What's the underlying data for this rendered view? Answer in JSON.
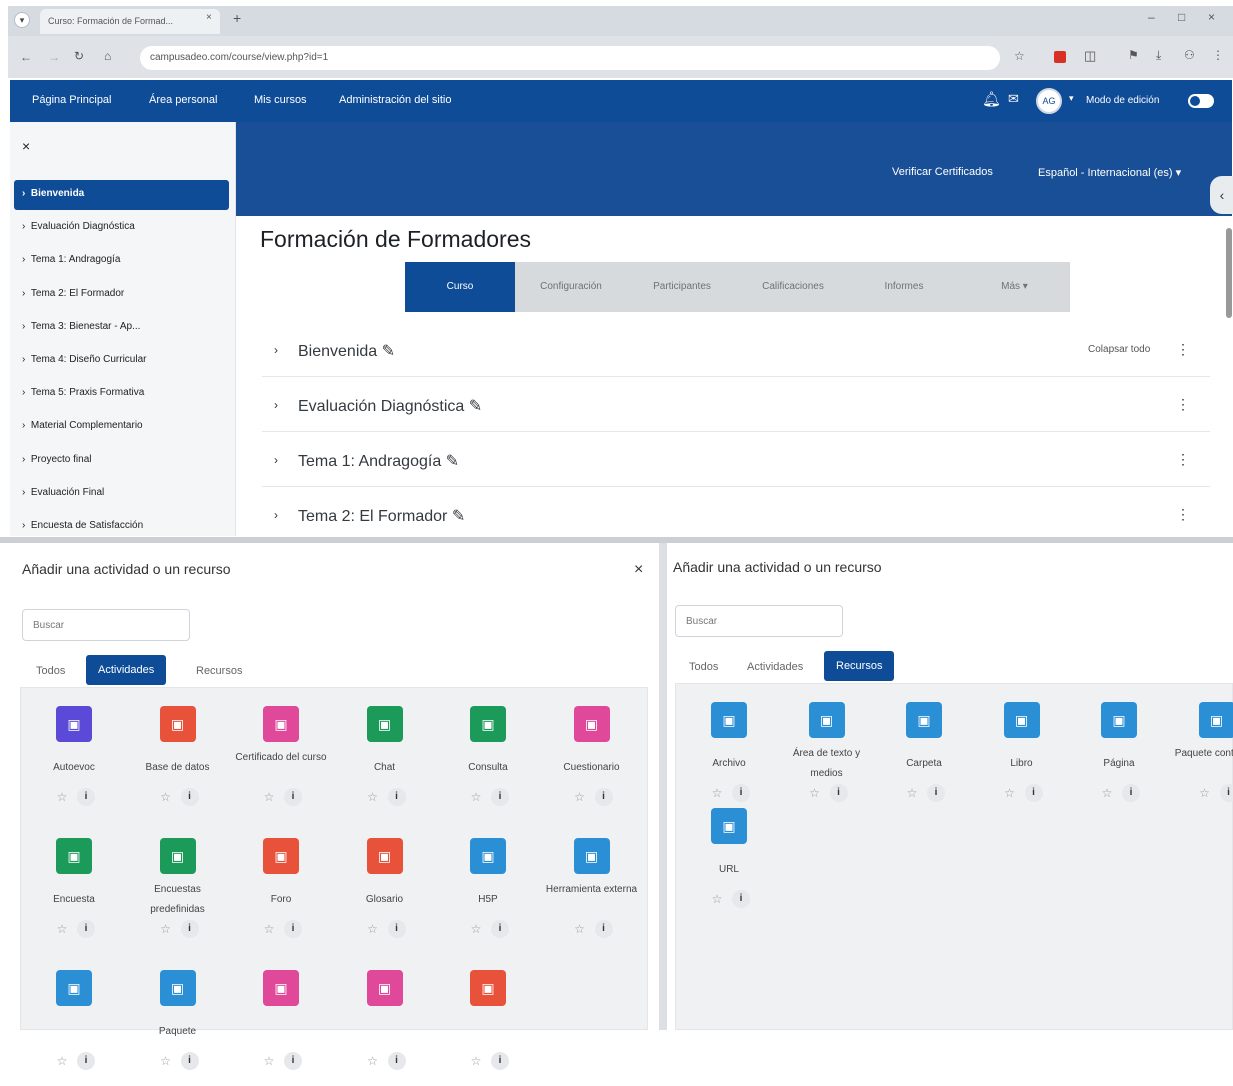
{
  "browser": {
    "tab_title": "Curso: Formación de Formad...",
    "tab_close": "×",
    "new_tab": "+",
    "address": "campusadeo.com/course/view.php?id=1",
    "window_controls": [
      "–",
      "□",
      "×"
    ]
  },
  "navbar": {
    "links": [
      "Página Principal",
      "Área personal",
      "Mis cursos",
      "Administración del sitio"
    ],
    "avatar_initials": "AG",
    "edit_mode_label": "Modo de edición"
  },
  "drawer": {
    "close_icon": "×",
    "items": [
      "Bienvenida",
      "Evaluación Diagnóstica",
      "Tema 1: Andragogía",
      "Tema 2: El Formador",
      "Tema 3: Bienestar - Ap...",
      "Tema 4: Diseño Curricular",
      "Tema 5: Praxis Formativa",
      "Material Complementario",
      "Proyecto final",
      "Evaluación Final",
      "Encuesta de Satisfacción"
    ]
  },
  "header": {
    "verify_link": "Verificar Certificados",
    "language": "Español - Internacional (es) ▾"
  },
  "course": {
    "title": "Formación de Formadores",
    "tabs": [
      "Curso",
      "Configuración",
      "Participantes",
      "Calificaciones",
      "Informes",
      "Más ▾"
    ],
    "collapse_all": "Colapsar todo",
    "sections": [
      "Bienvenida",
      "Evaluación Diagnóstica",
      "Tema 1: Andragogía",
      "Tema 2: El Formador"
    ]
  },
  "left_panel": {
    "title": "Añadir una actividad o un recurso",
    "close": "×",
    "search_placeholder": "Buscar",
    "tabs": [
      "Todos",
      "Actividades",
      "Recursos"
    ],
    "cards": [
      {
        "name": "Autoevoc",
        "color": "#5b4ad8",
        "icon": "user-icon"
      },
      {
        "name": "Base de datos",
        "color": "#e8523a",
        "icon": "database-icon"
      },
      {
        "name": "Certificado del curso",
        "color": "#e0499a",
        "icon": "certificate-icon"
      },
      {
        "name": "Chat",
        "color": "#1b9a5a",
        "icon": "chat-icon"
      },
      {
        "name": "Consulta",
        "color": "#1b9a5a",
        "icon": "choice-icon"
      },
      {
        "name": "Cuestionario",
        "color": "#e0499a",
        "icon": "quiz-icon"
      },
      {
        "name": "Encuesta",
        "color": "#1b9a5a",
        "icon": "megaphone-icon"
      },
      {
        "name": "Encuestas predefinidas",
        "color": "#1b9a5a",
        "icon": "survey-icon"
      },
      {
        "name": "Foro",
        "color": "#e8523a",
        "icon": "forum-icon"
      },
      {
        "name": "Glosario",
        "color": "#e8523a",
        "icon": "glossary-icon"
      },
      {
        "name": "H5P",
        "color": "#2b8fd6",
        "icon": "h5p-icon"
      },
      {
        "name": "Herramienta externa",
        "color": "#2b8fd6",
        "icon": "puzzle-icon"
      },
      {
        "name": "",
        "color": "#2b8fd6",
        "icon": "lesson-icon"
      },
      {
        "name": "Paquete",
        "color": "#2b8fd6",
        "icon": "package-icon"
      },
      {
        "name": "",
        "color": "#e0499a",
        "icon": "workshop-icon"
      },
      {
        "name": "",
        "color": "#e0499a",
        "icon": "assignment-icon"
      },
      {
        "name": "",
        "color": "#e8523a",
        "icon": "wiki-icon"
      }
    ]
  },
  "right_panel": {
    "title": "Añadir una actividad o un recurso",
    "search_placeholder": "Buscar",
    "tabs": [
      "Todos",
      "Actividades",
      "Recursos"
    ],
    "cards": [
      {
        "name": "Archivo",
        "color": "#2b8fd6",
        "icon": "file-icon"
      },
      {
        "name": "Área de texto y medios",
        "color": "#2b8fd6",
        "icon": "media-icon"
      },
      {
        "name": "Carpeta",
        "color": "#2b8fd6",
        "icon": "folder-icon"
      },
      {
        "name": "Libro",
        "color": "#2b8fd6",
        "icon": "book-icon"
      },
      {
        "name": "Página",
        "color": "#2b8fd6",
        "icon": "page-icon"
      },
      {
        "name": "Paquete contenido",
        "color": "#2b8fd6",
        "icon": "package-icon"
      },
      {
        "name": "URL",
        "color": "#2b8fd6",
        "icon": "globe-icon"
      }
    ]
  },
  "card_icons": {
    "star": "☆",
    "info": "●"
  }
}
